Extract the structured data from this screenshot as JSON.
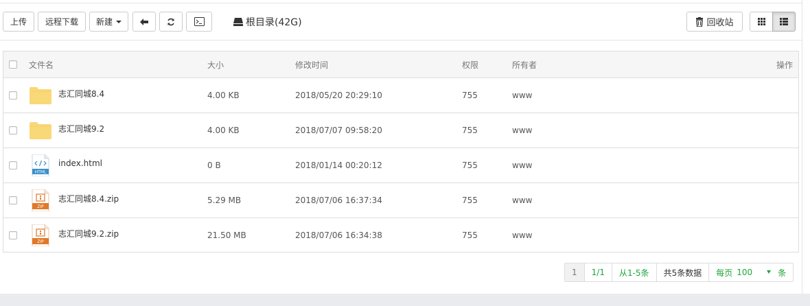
{
  "toolbar": {
    "upload_label": "上传",
    "remote_download_label": "远程下载",
    "new_label": "新建",
    "path_text": "根目录(42G)",
    "recycle_label": "回收站"
  },
  "icons": {
    "back": "arrow-left-icon",
    "refresh": "refresh-icon",
    "terminal": "terminal-icon",
    "disk": "hard-drive-icon",
    "trash": "trash-icon",
    "grid": "grid-view-icon",
    "list": "list-view-icon",
    "folder": "folder-icon",
    "html": "html-file-icon",
    "zip": "zip-file-icon"
  },
  "table": {
    "headers": {
      "name": "文件名",
      "size": "大小",
      "mtime": "修改时间",
      "perm": "权限",
      "owner": "所有者",
      "actions": "操作"
    },
    "rows": [
      {
        "name": "志汇同城8.4",
        "type": "folder",
        "size": "4.00 KB",
        "mtime": "2018/05/20 20:29:10",
        "perm": "755",
        "owner": "www"
      },
      {
        "name": "志汇同城9.2",
        "type": "folder",
        "size": "4.00 KB",
        "mtime": "2018/07/07 09:58:20",
        "perm": "755",
        "owner": "www"
      },
      {
        "name": "index.html",
        "type": "html",
        "size": "0 B",
        "mtime": "2018/01/14 00:20:12",
        "perm": "755",
        "owner": "www"
      },
      {
        "name": "志汇同城8.4.zip",
        "type": "zip",
        "size": "5.29 MB",
        "mtime": "2018/07/06 16:37:34",
        "perm": "755",
        "owner": "www"
      },
      {
        "name": "志汇同城9.2.zip",
        "type": "zip",
        "size": "21.50 MB",
        "mtime": "2018/07/06 16:34:38",
        "perm": "755",
        "owner": "www"
      }
    ]
  },
  "pager": {
    "current": "1",
    "page_of": "1/1",
    "range": "从1-5条",
    "total": "共5条数据",
    "per_page_label": "每页",
    "per_page_value": "100",
    "unit": "条"
  },
  "colors": {
    "accent_green": "#20a53a",
    "folder": "#f9d878",
    "html_blue": "#3a8fc8",
    "zip_orange": "#e0792a"
  }
}
